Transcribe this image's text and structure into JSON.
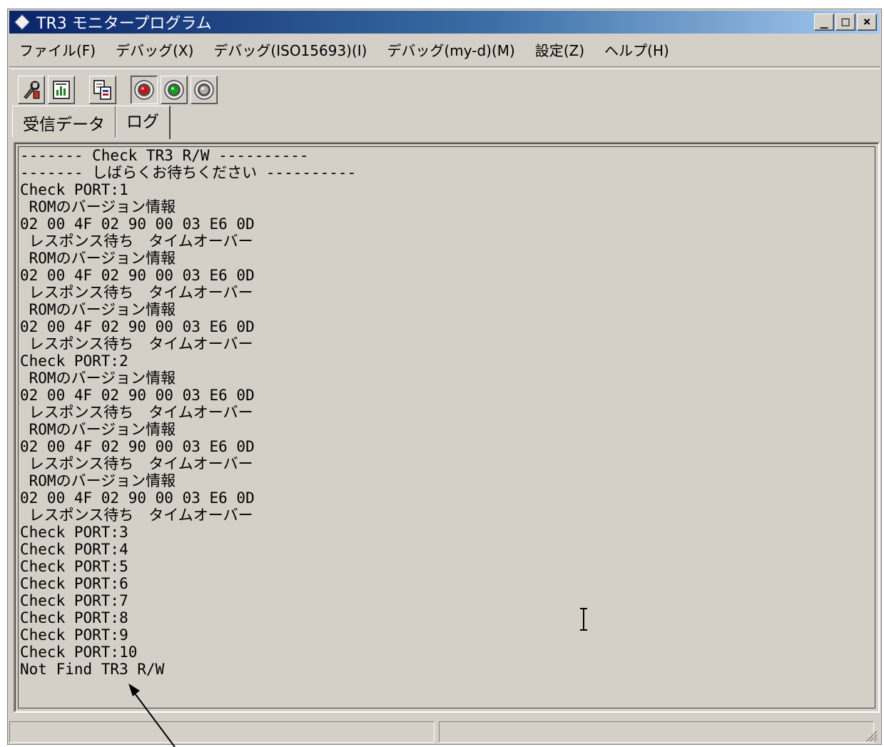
{
  "window": {
    "title": "TR3 モニタープログラム",
    "controls": [
      "_",
      "□",
      "×"
    ]
  },
  "menu": [
    "ファイル(F)",
    "デバッグ(X)",
    "デバッグ(ISO15693)(I)",
    "デバッグ(my-d)(M)",
    "設定(Z)",
    "ヘルプ(H)"
  ],
  "toolbar": {
    "icons": [
      "tools-icon",
      "chart-icon",
      "copy-icon",
      "red-light-icon",
      "green-light-icon",
      "gray-light-icon"
    ],
    "colors": {
      "red": "#d01010",
      "green": "#10a020",
      "gray": "#b0b0a8"
    }
  },
  "tabs": [
    {
      "label": "受信データ",
      "active": false
    },
    {
      "label": "ログ",
      "active": true
    }
  ],
  "log": [
    "------- Check TR3 R/W ----------",
    "------- しばらくお待ちください ----------",
    "Check PORT:1",
    " ROMのバージョン情報",
    "02 00 4F 02 90 00 03 E6 0D",
    " レスポンス待ち　タイムオーバー",
    " ROMのバージョン情報",
    "02 00 4F 02 90 00 03 E6 0D",
    " レスポンス待ち　タイムオーバー",
    " ROMのバージョン情報",
    "02 00 4F 02 90 00 03 E6 0D",
    " レスポンス待ち　タイムオーバー",
    "Check PORT:2",
    " ROMのバージョン情報",
    "02 00 4F 02 90 00 03 E6 0D",
    " レスポンス待ち　タイムオーバー",
    " ROMのバージョン情報",
    "02 00 4F 02 90 00 03 E6 0D",
    " レスポンス待ち　タイムオーバー",
    " ROMのバージョン情報",
    "02 00 4F 02 90 00 03 E6 0D",
    " レスポンス待ち　タイムオーバー",
    "Check PORT:3",
    "Check PORT:4",
    "Check PORT:5",
    "Check PORT:6",
    "Check PORT:7",
    "Check PORT:8",
    "Check PORT:9",
    "Check PORT:10",
    "Not Find TR3 R/W"
  ],
  "status": [
    "",
    ""
  ]
}
